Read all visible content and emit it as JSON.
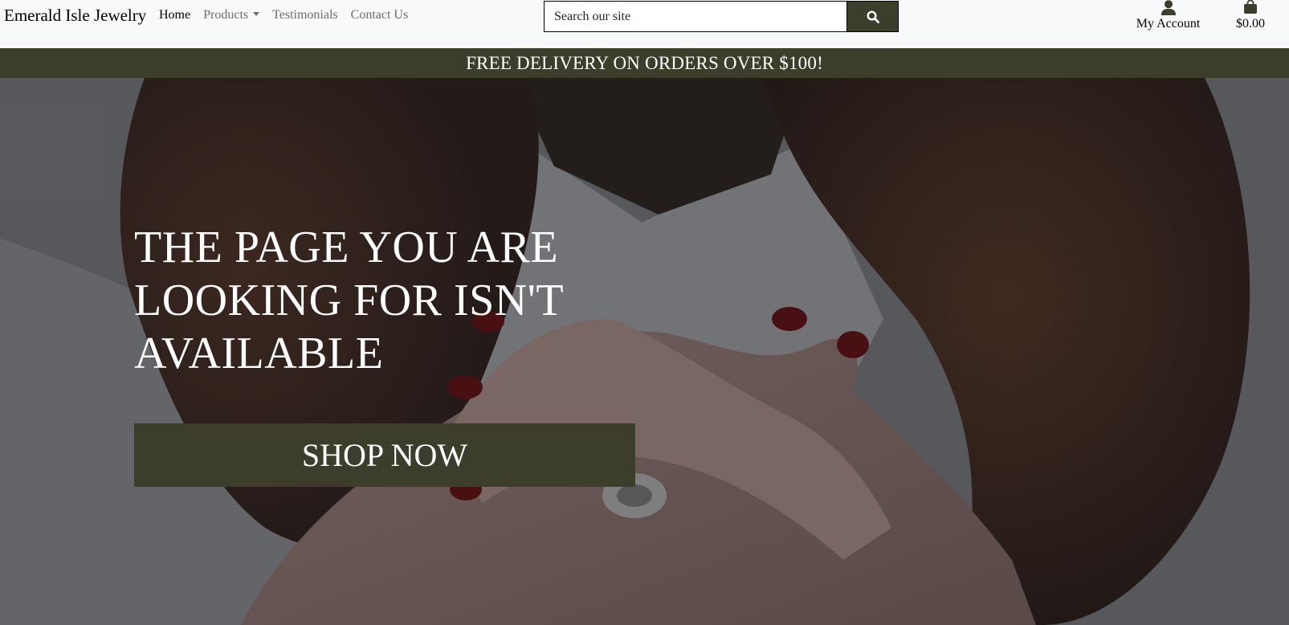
{
  "brand": {
    "name": "Emerald Isle Jewelry"
  },
  "nav": {
    "items": [
      {
        "label": "Home",
        "active": true
      },
      {
        "label": "Products",
        "dropdown": true
      },
      {
        "label": "Testimonials"
      },
      {
        "label": "Contact Us"
      }
    ]
  },
  "search": {
    "placeholder": "Search our site",
    "button_icon": "search-icon"
  },
  "account": {
    "label": "My Account",
    "icon": "user-icon"
  },
  "cart": {
    "total": "$0.00",
    "icon": "shopping-bag-icon"
  },
  "banner": {
    "text": "FREE DELIVERY ON ORDERS OVER $100!"
  },
  "hero": {
    "title": "THE PAGE YOU ARE LOOKING FOR ISN'T AVAILABLE",
    "cta_label": "SHOP NOW"
  },
  "colors": {
    "accent": "#3d3d2b",
    "navbar_bg": "#f8f9fa",
    "text_light": "#ffffff"
  }
}
